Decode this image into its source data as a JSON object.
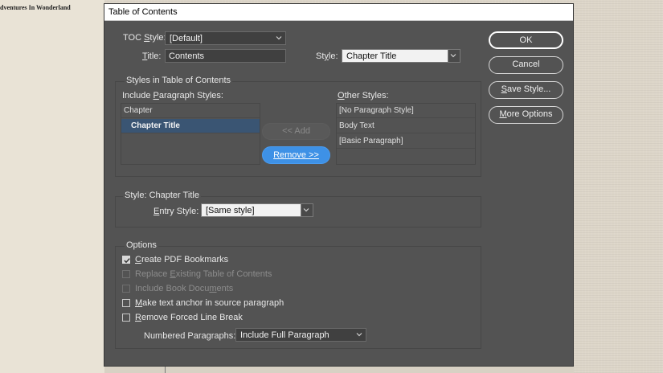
{
  "document": {
    "title_fragment": "dventures In Wonderland"
  },
  "dialog": {
    "title": "Table of Contents",
    "toc_style": {
      "label": "TOC Style:",
      "label_u": "S",
      "value": "[Default]"
    },
    "title_field": {
      "label": "Title:",
      "label_u": "T",
      "value": "Contents"
    },
    "style_field": {
      "label": "Style:",
      "label_u": "y",
      "value": "Chapter Title"
    },
    "styles_group": {
      "title": "Styles in Table of Contents",
      "include_label": "Include Paragraph Styles:",
      "include_items": [
        "Chapter",
        "Chapter Title"
      ],
      "selected_include": "Chapter Title",
      "add_button": "<< Add",
      "remove_button": "Remove >>",
      "other_label": "Other Styles:",
      "other_items": [
        "[No Paragraph Style]",
        "Body Text",
        "[Basic Paragraph]"
      ]
    },
    "style_section": {
      "title": "Style: Chapter Title",
      "entry_label": "Entry Style:",
      "entry_value": "[Same style]"
    },
    "options": {
      "title": "Options",
      "checkboxes": [
        {
          "label": "Create PDF Bookmarks",
          "checked": true,
          "enabled": true
        },
        {
          "label": "Replace Existing Table of Contents",
          "checked": false,
          "enabled": false
        },
        {
          "label": "Include Book Documents",
          "checked": false,
          "enabled": false
        },
        {
          "label": "Make text anchor in source paragraph",
          "checked": false,
          "enabled": true
        },
        {
          "label": "Remove Forced Line Break",
          "checked": false,
          "enabled": true
        }
      ],
      "numbered_label": "Numbered Paragraphs:",
      "numbered_value": "Include Full Paragraph"
    },
    "buttons": {
      "ok": "OK",
      "cancel": "Cancel",
      "save_style": "Save Style...",
      "more_options": "More Options"
    }
  },
  "colors": {
    "dialog_bg": "#535353",
    "accent_blue": "#3e91e6",
    "selection": "#3a5573"
  }
}
